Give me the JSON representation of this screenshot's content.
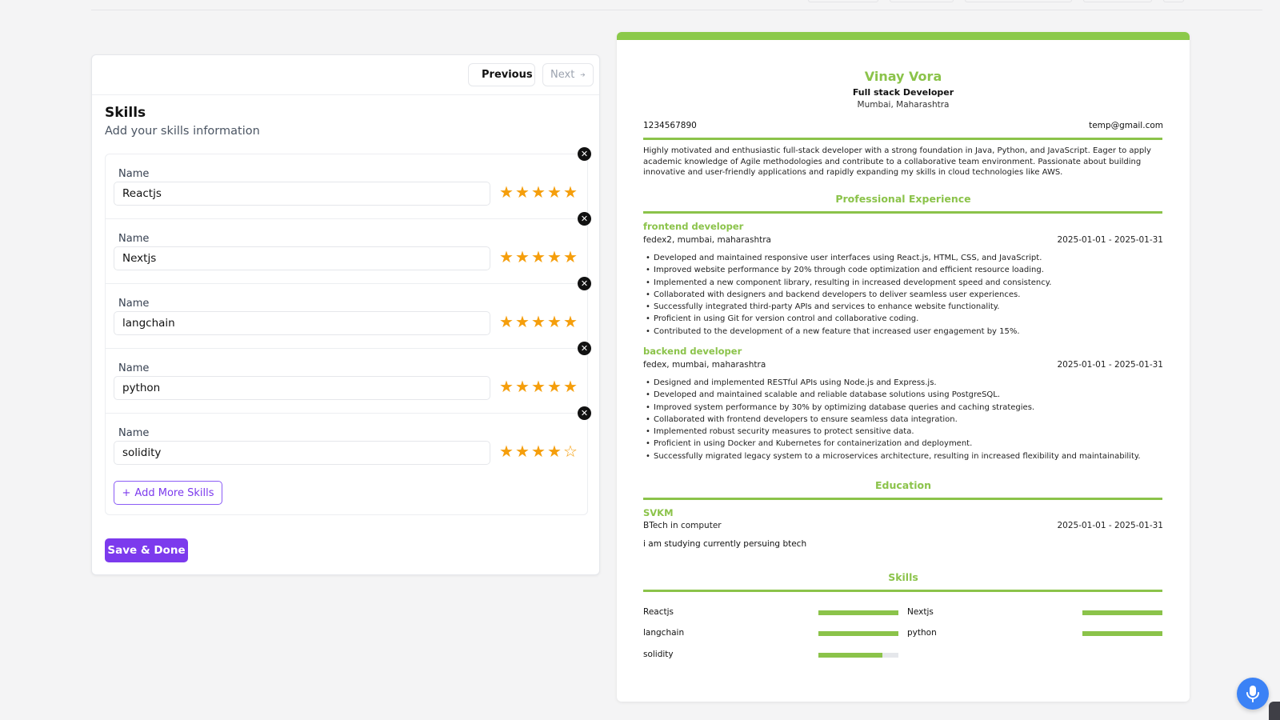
{
  "nav": {
    "previous": "Previous",
    "next": "Next"
  },
  "section": {
    "title": "Skills",
    "subtitle": "Add your skills information"
  },
  "skills": [
    {
      "label": "Name",
      "value": "Reactjs",
      "rating": 5
    },
    {
      "label": "Name",
      "value": "Nextjs",
      "rating": 5
    },
    {
      "label": "Name",
      "value": "langchain",
      "rating": 5
    },
    {
      "label": "Name",
      "value": "python",
      "rating": 5
    },
    {
      "label": "Name",
      "value": "solidity",
      "rating": 4
    }
  ],
  "add_more_label": "Add More Skills",
  "save_label": "Save & Done",
  "resume": {
    "name": "Vinay Vora",
    "job_title": "Full stack Developer",
    "location": "Mumbai, Maharashtra",
    "phone": "1234567890",
    "email": "temp@gmail.com",
    "summary": "Highly motivated and enthusiastic full-stack developer with a strong foundation in Java, Python, and JavaScript. Eager to apply academic knowledge of Agile methodologies and contribute to a collaborative team environment. Passionate about building innovative and user-friendly applications and rapidly expanding my skills in cloud technologies like AWS.",
    "experience_heading": "Professional Experience",
    "experience": [
      {
        "role": "frontend developer",
        "company": "fedex2, mumbai, maharashtra",
        "dates": "2025-01-01 - 2025-01-31",
        "points": [
          "Developed and maintained responsive user interfaces using React.js, HTML, CSS, and JavaScript.",
          "Improved website performance by 20% through code optimization and efficient resource loading.",
          "Implemented a new component library, resulting in increased development speed and consistency.",
          "Collaborated with designers and backend developers to deliver seamless user experiences.",
          "Successfully integrated third-party APIs and services to enhance website functionality.",
          "Proficient in using Git for version control and collaborative coding.",
          "Contributed to the development of a new feature that increased user engagement by 15%."
        ]
      },
      {
        "role": "backend developer",
        "company": "fedex, mumbai, maharashtra",
        "dates": "2025-01-01 - 2025-01-31",
        "points": [
          "Designed and implemented RESTful APIs using Node.js and Express.js.",
          "Developed and maintained scalable and reliable database solutions using PostgreSQL.",
          "Improved system performance by 30% by optimizing database queries and caching strategies.",
          "Collaborated with frontend developers to ensure seamless data integration.",
          "Implemented robust security measures to protect sensitive data.",
          "Proficient in using Docker and Kubernetes for containerization and deployment.",
          "Successfully migrated legacy system to a microservices architecture, resulting in increased flexibility and maintainability."
        ]
      }
    ],
    "education_heading": "Education",
    "education": {
      "school": "SVKM",
      "degree": "BTech in computer",
      "dates": "2025-01-01 - 2025-01-31",
      "description": "i am studying currently persuing btech"
    },
    "skills_heading": "Skills",
    "skills": [
      {
        "name": "Reactjs",
        "level": 1.0
      },
      {
        "name": "Nextjs",
        "level": 1.0
      },
      {
        "name": "langchain",
        "level": 1.0
      },
      {
        "name": "python",
        "level": 1.0
      },
      {
        "name": "solidity",
        "level": 0.8
      }
    ]
  },
  "colors": {
    "accent": "#8bc34a",
    "primary": "#7c3aed",
    "star": "#f59e0b",
    "mic": "#3b82f6"
  },
  "icons": {
    "previous": "arrow-left-icon",
    "next": "arrow-right-icon",
    "remove": "close-icon",
    "add": "plus-icon",
    "mic": "microphone-icon",
    "star": "star-icon"
  }
}
